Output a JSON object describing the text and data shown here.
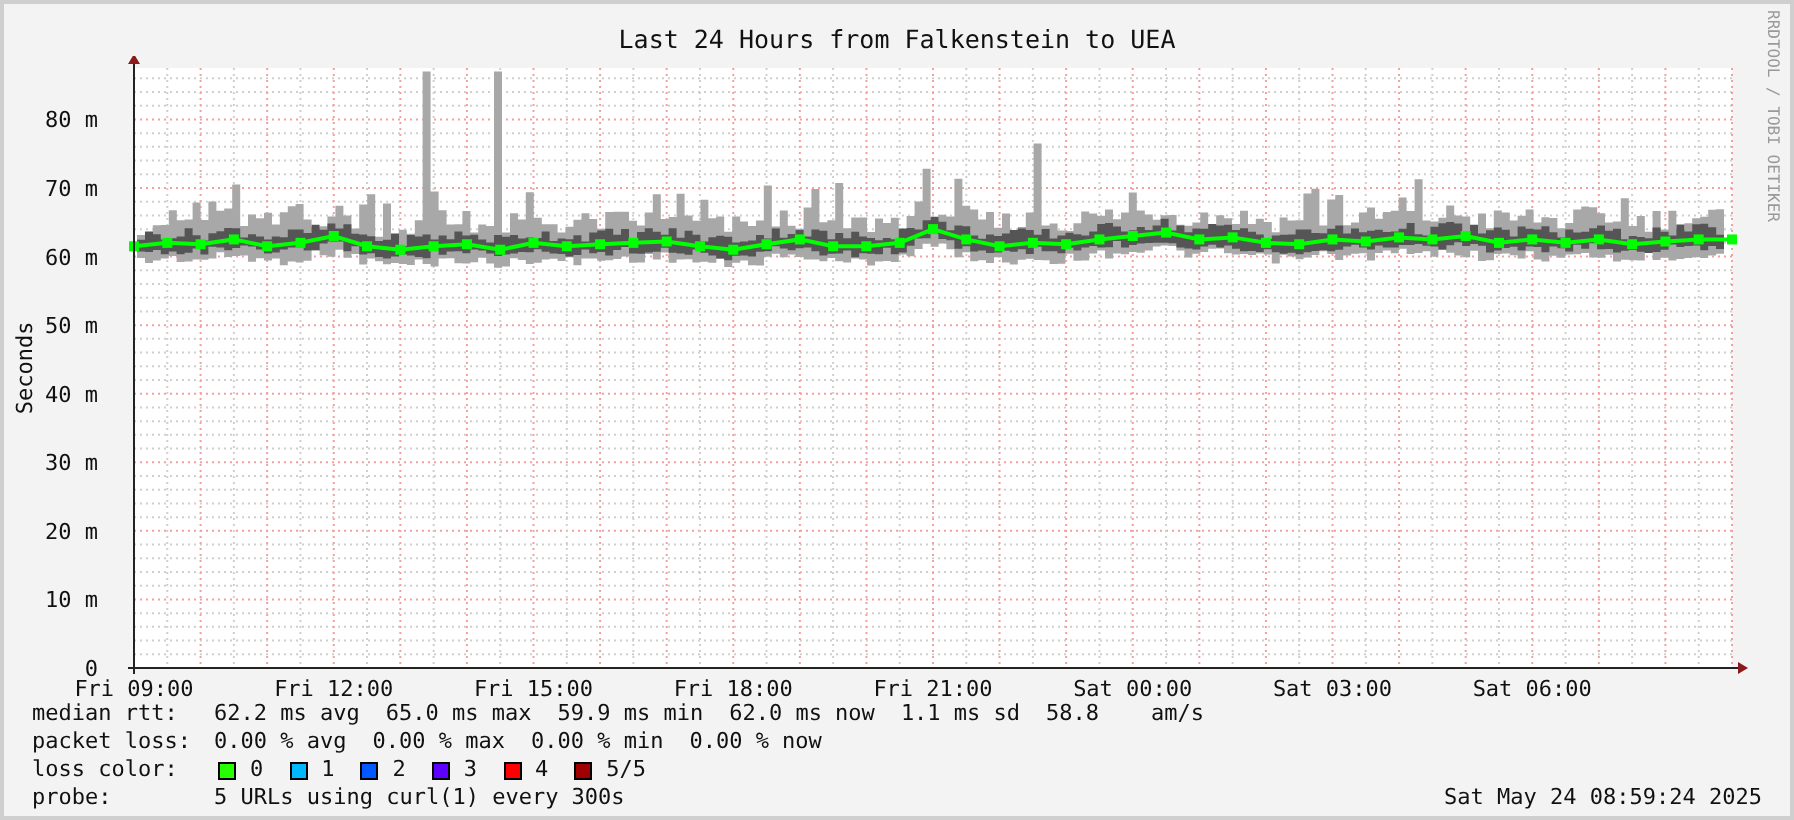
{
  "title": "Last 24 Hours from Falkenstein to UEA",
  "credit": "RRDTOOL / TOBI OETIKER",
  "chart": {
    "chart_data": {
      "type": "line",
      "grid": true,
      "ylabel": "Seconds",
      "ylim": [
        0,
        87.5
      ],
      "categories": [
        "Fri 09:00",
        null,
        null,
        null,
        null,
        null,
        "Fri 12:00",
        null,
        null,
        null,
        null,
        null,
        "Fri 15:00",
        null,
        null,
        null,
        null,
        null,
        "Fri 18:00",
        null,
        null,
        null,
        null,
        null,
        "Fri 21:00",
        null,
        null,
        null,
        null,
        null,
        "Sat 00:00",
        null,
        null,
        null,
        null,
        null,
        "Sat 03:00",
        null,
        null,
        null,
        null,
        null,
        "Sat 06:00",
        null,
        null,
        null,
        null,
        null,
        null
      ],
      "yticks": [
        0,
        {
          "value": 10,
          "label": "10 m"
        },
        {
          "value": 20,
          "label": "20 m"
        },
        {
          "value": 30,
          "label": "30 m"
        },
        {
          "value": 40,
          "label": "40 m"
        },
        {
          "value": 50,
          "label": "50 m"
        },
        {
          "value": 60,
          "label": "60 m"
        },
        {
          "value": 70,
          "label": "70 m"
        },
        {
          "value": 80,
          "label": "80 m"
        }
      ],
      "series": [
        {
          "color": "#00ff00",
          "marker": "square",
          "values": [
            61.5,
            62,
            61.8,
            62.5,
            61.5,
            62,
            63,
            61.5,
            61,
            61.5,
            61.8,
            61,
            62,
            61.5,
            61.8,
            62,
            62.2,
            61.5,
            61,
            61.8,
            62.5,
            61.5,
            61.5,
            62,
            64,
            62.5,
            61.5,
            62,
            61.8,
            62.5,
            63,
            63.5,
            62.5,
            62.8,
            62,
            61.8,
            62.5,
            62.2,
            62.8,
            62.5,
            63,
            62,
            62.5,
            62,
            62.5,
            61.8,
            62.2,
            62.5,
            62.5
          ]
        }
      ]
    }
  },
  "legend": {
    "median_rtt": {
      "label": "median rtt:",
      "values": [
        "62.2 ms avg",
        "65.0 ms max",
        "59.9 ms min",
        "62.0 ms now",
        "1.1 ms sd",
        "58.8",
        "am/s"
      ]
    },
    "packet_loss": {
      "label": "packet loss:",
      "values": [
        "0.00 % avg",
        "0.00 % max",
        "0.00 % min",
        "0.00 % now"
      ]
    },
    "loss_color": {
      "label": "loss color:",
      "items": [
        {
          "label": "0",
          "color": "#26ff00"
        },
        {
          "label": "1",
          "color": "#00b8ff"
        },
        {
          "label": "2",
          "color": "#0059ff"
        },
        {
          "label": "3",
          "color": "#5e00ff"
        },
        {
          "label": "4",
          "color": "#ff0000"
        },
        {
          "label": "5/5",
          "color": "#a10000"
        }
      ]
    },
    "probe": {
      "label": "probe:",
      "value": "5 URLs using curl(1) every 300s"
    },
    "timestamp": "Sat May 24 08:59:24 2025"
  }
}
